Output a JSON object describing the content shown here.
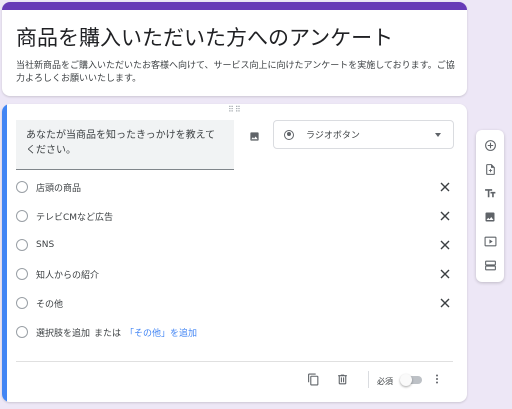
{
  "form": {
    "title": "商品を購入いただいた方へのアンケート",
    "description": "当社新商品をご購入いただいたお客様へ向けて、サービス向上に向けたアンケートを実施しております。ご協力よろしくお願いいたします。"
  },
  "question": {
    "title": "あなたが当商品を知ったきっかけを教えてください。",
    "type_label": "ラジオボタン",
    "options": [
      {
        "label": "店頭の商品"
      },
      {
        "label": "テレビCMなど広告"
      },
      {
        "label": "SNS"
      },
      {
        "label": "知人からの紹介"
      },
      {
        "label": "その他"
      }
    ],
    "add_option_label": "選択肢を追加",
    "or_label": "または",
    "add_other_label": "「その他」を追加",
    "required_label": "必須",
    "required": false
  },
  "toolbar": {
    "items": [
      {
        "icon": "add-circle-icon"
      },
      {
        "icon": "import-question-icon"
      },
      {
        "icon": "title-text-icon"
      },
      {
        "icon": "image-icon"
      },
      {
        "icon": "video-icon"
      },
      {
        "icon": "section-icon"
      }
    ]
  },
  "colors": {
    "accent": "#673ab7",
    "active_bar": "#4285f4",
    "background": "#ede7f6"
  }
}
